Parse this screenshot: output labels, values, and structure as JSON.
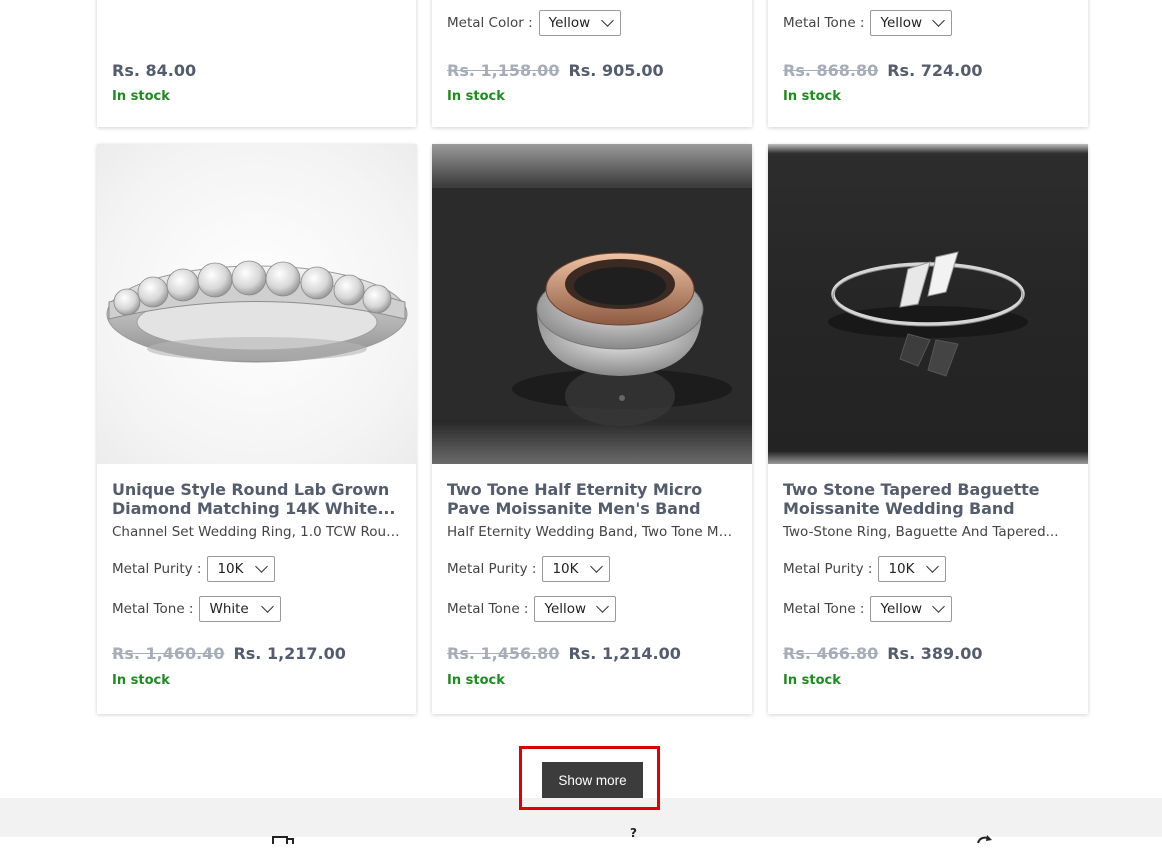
{
  "top_row": [
    {
      "options": [],
      "old_price": "",
      "price": "Rs. 84.00",
      "stock": "In stock"
    },
    {
      "options": [
        {
          "label": "Metal Color :",
          "value": "Yellow"
        }
      ],
      "old_price": "Rs. 1,158.00",
      "price": "Rs. 905.00",
      "stock": "In stock"
    },
    {
      "options": [
        {
          "label": "Metal Tone :",
          "value": "Yellow"
        }
      ],
      "old_price": "Rs. 868.80",
      "price": "Rs. 724.00",
      "stock": "In stock"
    }
  ],
  "products": [
    {
      "title": "Unique Style Round Lab Grown Diamond Matching 14K White...",
      "subtitle": "Channel Set Wedding Ring, 1.0 TCW Round...",
      "purity_label": "Metal Purity :",
      "purity": "10K",
      "tone_label": "Metal Tone :",
      "tone": "White",
      "old_price": "Rs. 1,460.40",
      "price": "Rs. 1,217.00",
      "stock": "In stock"
    },
    {
      "title": "Two Tone Half Eternity Micro Pave Moissanite Men's Band",
      "subtitle": "Half Eternity Wedding Band, Two Tone Men'...",
      "purity_label": "Metal Purity :",
      "purity": "10K",
      "tone_label": "Metal Tone :",
      "tone": "Yellow",
      "old_price": "Rs. 1,456.80",
      "price": "Rs. 1,214.00",
      "stock": "In stock"
    },
    {
      "title": "Two Stone Tapered Baguette Moissanite Wedding Band",
      "subtitle": "Two-Stone Ring, Baguette And Tapered...",
      "purity_label": "Metal Purity :",
      "purity": "10K",
      "tone_label": "Metal Tone :",
      "tone": "Yellow",
      "old_price": "Rs. 466.80",
      "price": "Rs. 389.00",
      "stock": "In stock"
    }
  ],
  "show_more_label": "Show more",
  "footer_icons": [
    "delivery-icon",
    "help-icon",
    "returns-icon"
  ],
  "colors": {
    "stock": "#1f8a1f",
    "highlight": "#e00000",
    "button": "#3c3c3c"
  }
}
